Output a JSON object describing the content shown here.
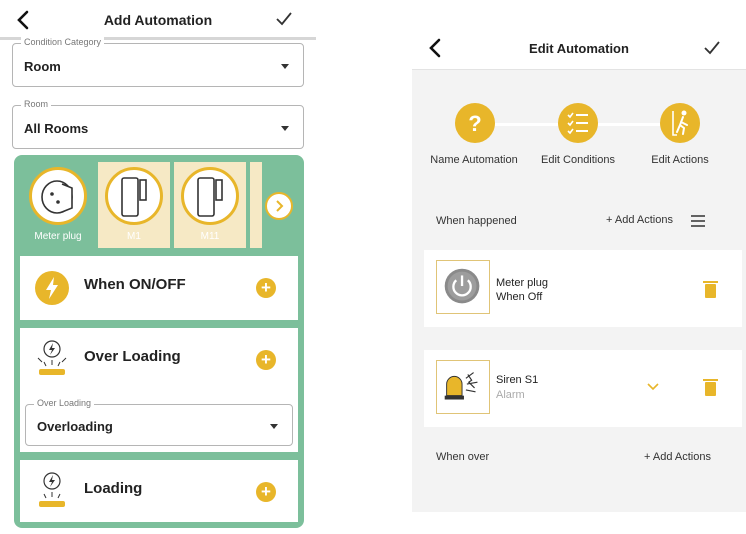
{
  "left": {
    "header": {
      "title": "Add Automation"
    },
    "condition_category": {
      "label": "Condition Category",
      "value": "Room"
    },
    "room": {
      "label": "Room",
      "value": "All Rooms"
    },
    "devices": [
      {
        "label": "Meter plug",
        "selected": true
      },
      {
        "label": "M1",
        "selected": false
      },
      {
        "label": "M11",
        "selected": false
      }
    ],
    "cards": {
      "when_onoff": {
        "title": "When ON/OFF"
      },
      "over_loading": {
        "title": "Over Loading",
        "field_label": "Over Loading",
        "field_value": "Overloading"
      },
      "loading": {
        "title": "Loading"
      }
    },
    "plus_symbol": "+"
  },
  "right": {
    "header": {
      "title": "Edit Automation"
    },
    "steps": [
      {
        "label": "Name Automation",
        "icon": "question-icon"
      },
      {
        "label": "Edit Conditions",
        "icon": "checklist-icon"
      },
      {
        "label": "Edit Actions",
        "icon": "walking-person-icon"
      }
    ],
    "when_happened": {
      "label": "When happened",
      "add_label": "+ Add Actions"
    },
    "actions": [
      {
        "name": "Meter plug",
        "state": "When Off",
        "icon": "power-icon"
      },
      {
        "name": "Siren S1",
        "state": "Alarm",
        "icon": "siren-icon"
      }
    ],
    "when_over": {
      "label": "When over",
      "add_label": "+ Add Actions"
    }
  },
  "colors": {
    "accent": "#e8b62a",
    "panel_green": "#7cbf9b",
    "device_bg": "#f6e9c5"
  }
}
